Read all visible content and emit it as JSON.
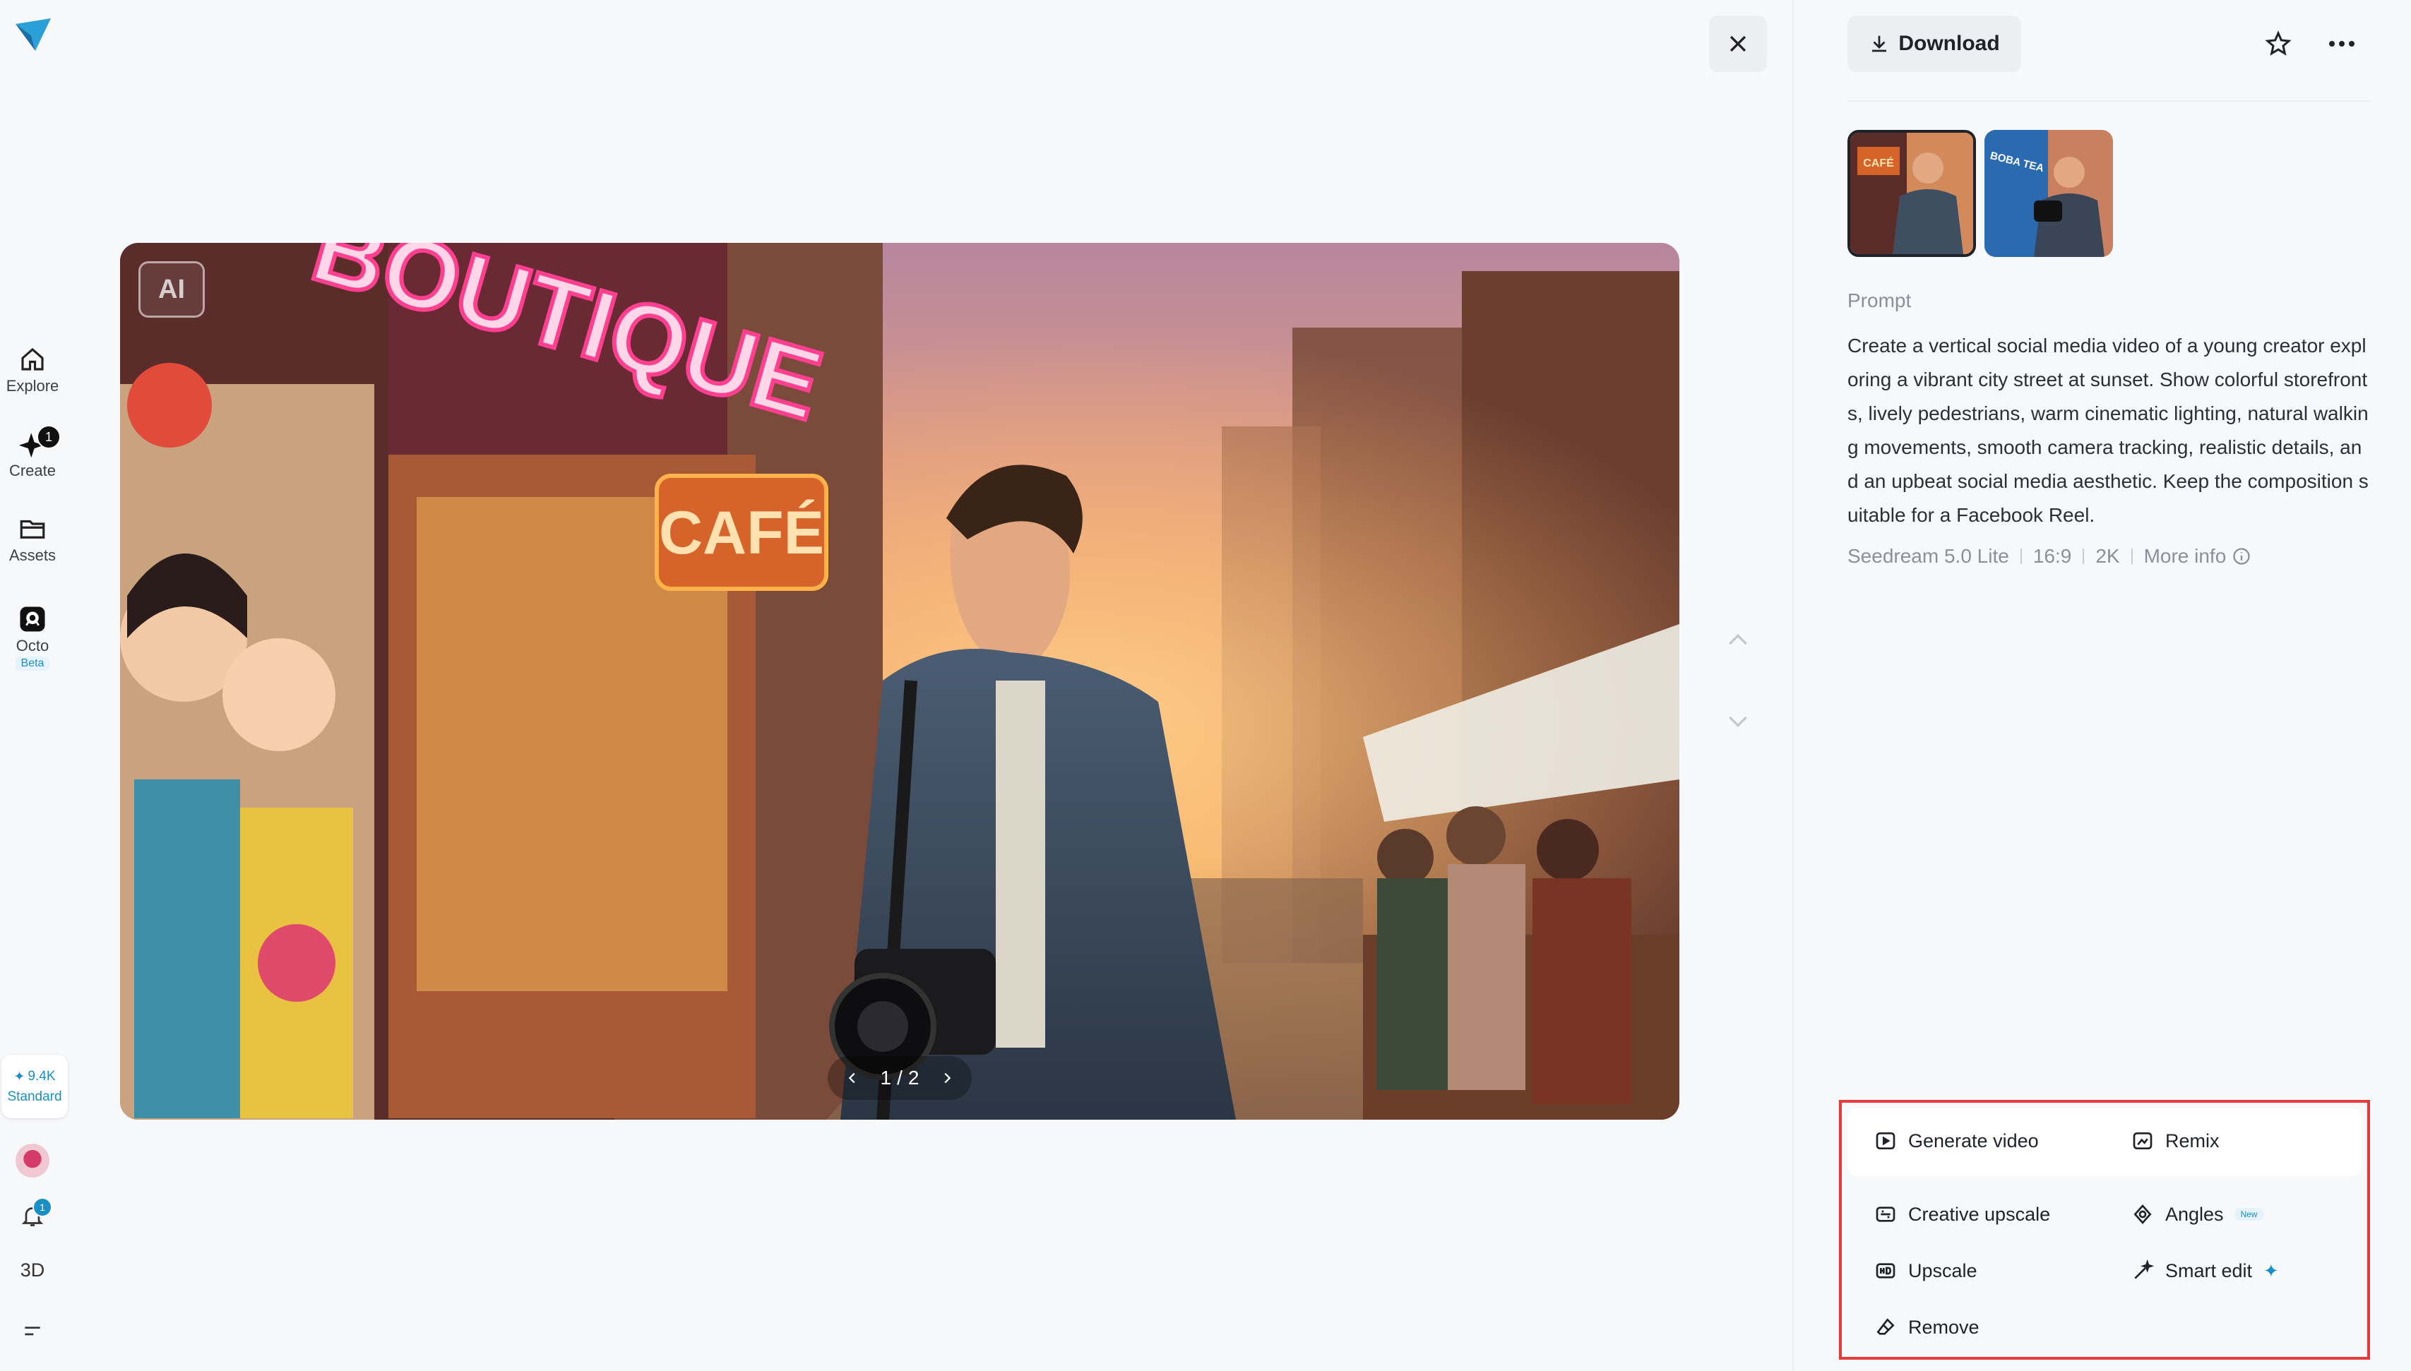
{
  "nav": {
    "items": [
      {
        "label": "Explore"
      },
      {
        "label": "Create",
        "badge": "1"
      },
      {
        "label": "Assets"
      },
      {
        "label": "Octo",
        "tag": "Beta"
      }
    ],
    "credits": {
      "amount": "9.4K",
      "plan": "Standard"
    },
    "notifications_badge": "1",
    "three_d_label": "3D"
  },
  "viewer": {
    "ai_label": "AI",
    "pager": {
      "current": "1",
      "total": "2",
      "separator": "/"
    },
    "scene_signs": {
      "boutique": "BOUTIQUE",
      "cafe": "CAFÉ"
    }
  },
  "panel": {
    "download_label": "Download",
    "thumbnails": [
      {
        "selected": true,
        "sign": "CAFÉ"
      },
      {
        "selected": false,
        "sign": "BOBA TEA"
      }
    ],
    "prompt_heading": "Prompt",
    "prompt_text": "Create a vertical social media video of a young creator exploring a vibrant city street at sunset. Show colorful storefronts, lively pedestrians, warm cinematic lighting, natural walking movements, smooth camera tracking, realistic details, and an upbeat social media aesthetic. Keep the composition suitable for a Facebook Reel.",
    "meta": {
      "model": "Seedream 5.0 Lite",
      "ratio": "16:9",
      "resolution": "2K",
      "more_info": "More info"
    },
    "actions": {
      "generate_video": "Generate video",
      "remix": "Remix",
      "creative_upscale": "Creative upscale",
      "angles": "Angles",
      "angles_tag": "New",
      "upscale": "Upscale",
      "smart_edit": "Smart edit",
      "remove": "Remove"
    }
  },
  "colors": {
    "accent": "#1a8fc4",
    "highlight_border": "#e63b3b"
  }
}
